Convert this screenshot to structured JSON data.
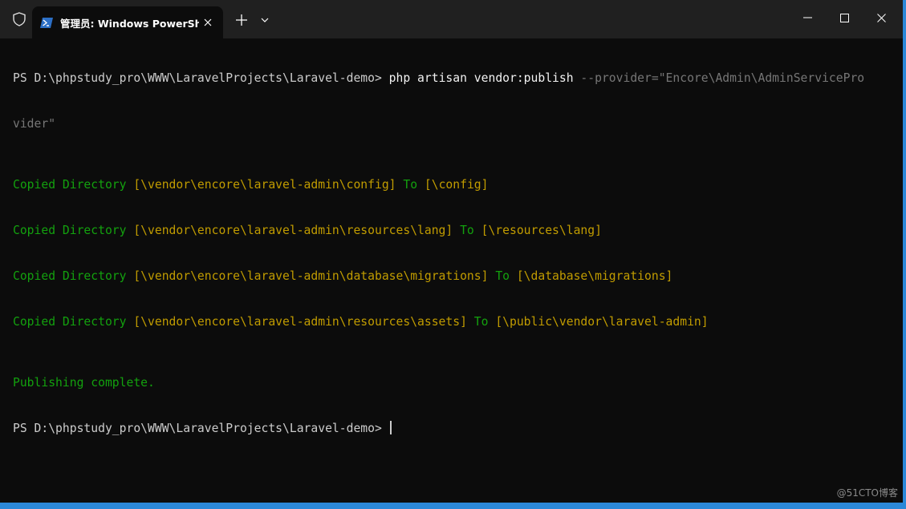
{
  "tab": {
    "title": "管理员: Windows PowerShell",
    "icon": "powershell-icon"
  },
  "titlebar": {
    "admin_icon": "shield-icon",
    "new_tab_icon": "plus-icon",
    "dropdown_icon": "chevron-down-icon"
  },
  "window_controls": {
    "minimize_icon": "minimize-icon",
    "maximize_icon": "maximize-icon",
    "close_icon": "close-icon"
  },
  "terminal": {
    "prompt": "PS D:\\phpstudy_pro\\WWW\\LaravelProjects\\Laravel-demo> ",
    "command": "php",
    "command_args": " artisan vendor:publish",
    "command_param": " --provider=\"Encore\\Admin\\AdminServicePro",
    "command_param_wrap": "vider\"",
    "copied_lines": [
      {
        "label": "Copied Directory",
        "from": "[\\vendor\\encore\\laravel-admin\\config]",
        "to_word": "To",
        "to": "[\\config]"
      },
      {
        "label": "Copied Directory",
        "from": "[\\vendor\\encore\\laravel-admin\\resources\\lang]",
        "to_word": "To",
        "to": "[\\resources\\lang]"
      },
      {
        "label": "Copied Directory",
        "from": "[\\vendor\\encore\\laravel-admin\\database\\migrations]",
        "to_word": "To",
        "to": "[\\database\\migrations]"
      },
      {
        "label": "Copied Directory",
        "from": "[\\vendor\\encore\\laravel-admin\\resources\\assets]",
        "to_word": "To",
        "to": "[\\public\\vendor\\laravel-admin]"
      }
    ],
    "complete_msg": "Publishing complete.",
    "final_prompt": "PS D:\\phpstudy_pro\\WWW\\LaravelProjects\\Laravel-demo> "
  },
  "watermark": "@51CTO博客",
  "colors": {
    "accent_border": "#2b88d8",
    "green": "#13a10e",
    "yellow": "#c19c00",
    "background": "#0c0c0c"
  }
}
